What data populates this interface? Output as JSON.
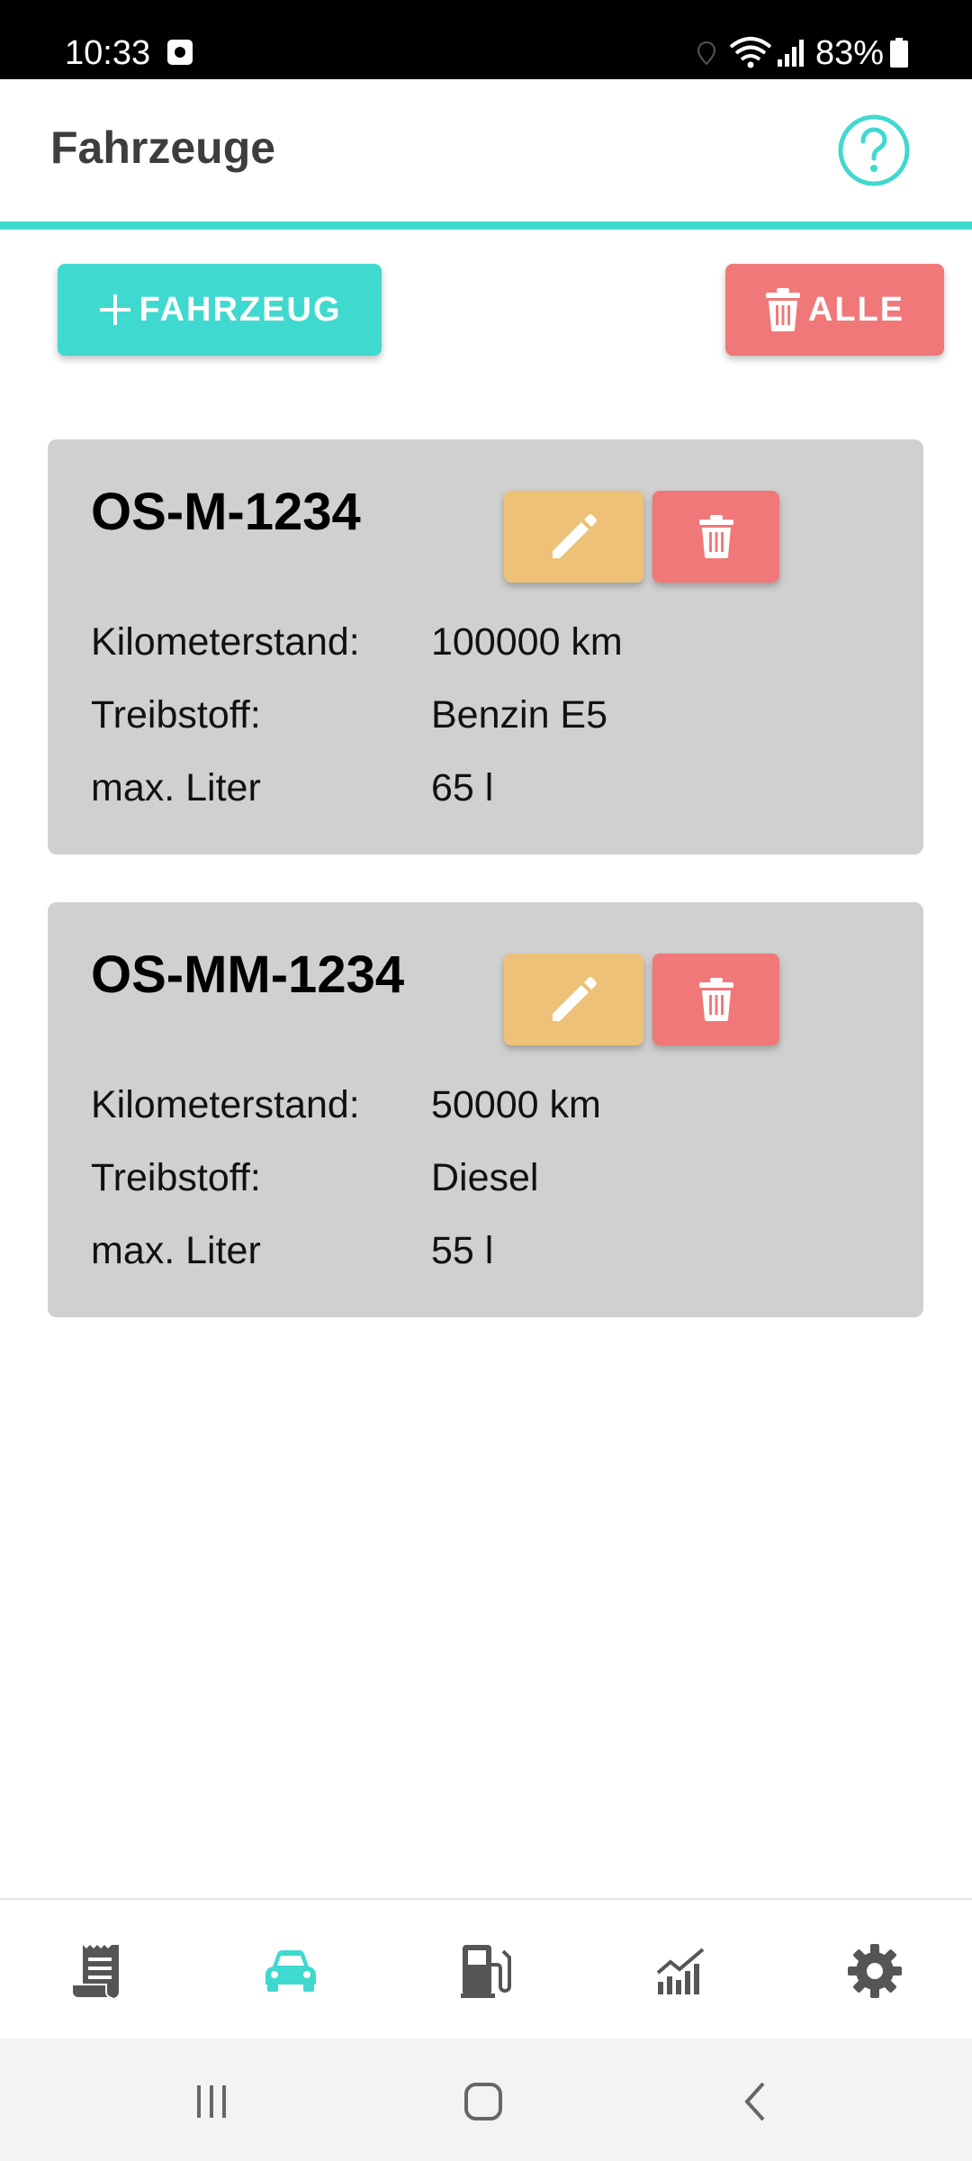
{
  "status_bar": {
    "time": "10:33",
    "battery": "83%",
    "icons": [
      "alarm-icon",
      "location-icon",
      "wifi-icon",
      "signal-icon",
      "battery-icon"
    ]
  },
  "app_bar": {
    "title": "Fahrzeuge",
    "help_icon": "help-circle-icon"
  },
  "actions": {
    "add_vehicle": {
      "icon": "plus",
      "label": "FAHRZEUG"
    },
    "delete_all": {
      "icon": "trash",
      "label": "ALLE"
    }
  },
  "vehicles": [
    {
      "plate": "OS-M-1234",
      "rows": [
        {
          "label": "Kilometerstand:",
          "value": "100000 km"
        },
        {
          "label": "Treibstoff:",
          "value": "Benzin E5"
        },
        {
          "label": "max. Liter",
          "value": "65 l"
        }
      ]
    },
    {
      "plate": "OS-MM-1234",
      "rows": [
        {
          "label": "Kilometerstand:",
          "value": "50000 km"
        },
        {
          "label": "Treibstoff:",
          "value": "Diesel"
        },
        {
          "label": "max. Liter",
          "value": "55 l"
        }
      ]
    }
  ],
  "bottom_nav": {
    "items": [
      {
        "icon": "receipt-icon",
        "active": false
      },
      {
        "icon": "car-icon",
        "active": true
      },
      {
        "icon": "gas-pump-icon",
        "active": false
      },
      {
        "icon": "chart-icon",
        "active": false
      },
      {
        "icon": "gear-icon",
        "active": false
      }
    ]
  },
  "colors": {
    "accent": "#40d9cf",
    "danger": "#f07878",
    "edit": "#edc278",
    "card": "#d0d0d0",
    "icon_inactive": "#555555"
  }
}
